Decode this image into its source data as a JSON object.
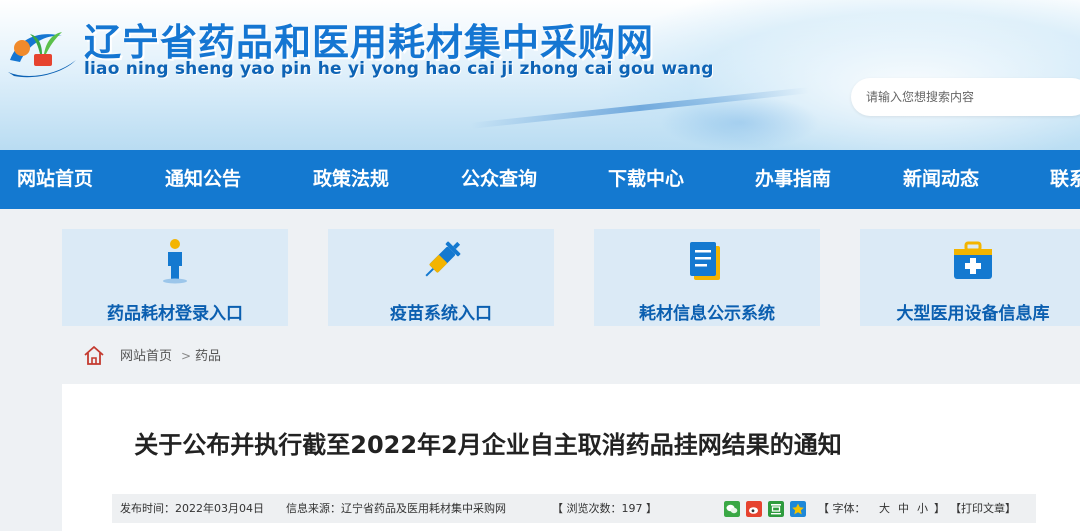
{
  "header": {
    "title": "辽宁省药品和医用耗材集中采购网",
    "pinyin": "liao ning sheng yao pin he yi yong hao cai ji zhong cai gou wang",
    "search_placeholder": "请输入您想搜索内容",
    "logo_icon": "seedling-hand-logo"
  },
  "nav": {
    "items": [
      {
        "label": "网站首页"
      },
      {
        "label": "通知公告"
      },
      {
        "label": "政策法规"
      },
      {
        "label": "公众查询"
      },
      {
        "label": "下载中心"
      },
      {
        "label": "办事指南"
      },
      {
        "label": "新闻动态"
      },
      {
        "label": "联系"
      }
    ],
    "color": "#1479d0"
  },
  "entries": [
    {
      "label": "药品耗材登录入口",
      "icon": "person-icon"
    },
    {
      "label": "疫苗系统入口",
      "icon": "syringe-icon"
    },
    {
      "label": "耗材信息公示系统",
      "icon": "document-icon"
    },
    {
      "label": "大型医用设备信息库",
      "icon": "medical-kit-icon"
    }
  ],
  "breadcrumb": {
    "home": "网站首页",
    "separator": ">",
    "current": "药品"
  },
  "article": {
    "title": "关于公布并执行截至2022年2月企业自主取消药品挂网结果的通知",
    "publish_time": "发布时间：2022年03月04日",
    "source": "信息来源：辽宁省药品及医用耗材集中采购网",
    "views": "【 浏览次数：197 】",
    "font_label": "【 字体：",
    "font_large": "大",
    "font_medium": "中",
    "font_small": "小",
    "font_close": "】",
    "print": "【打印文章】",
    "share_icons": [
      "wechat-icon",
      "weibo-icon",
      "douban-icon",
      "qzone-icon"
    ]
  }
}
